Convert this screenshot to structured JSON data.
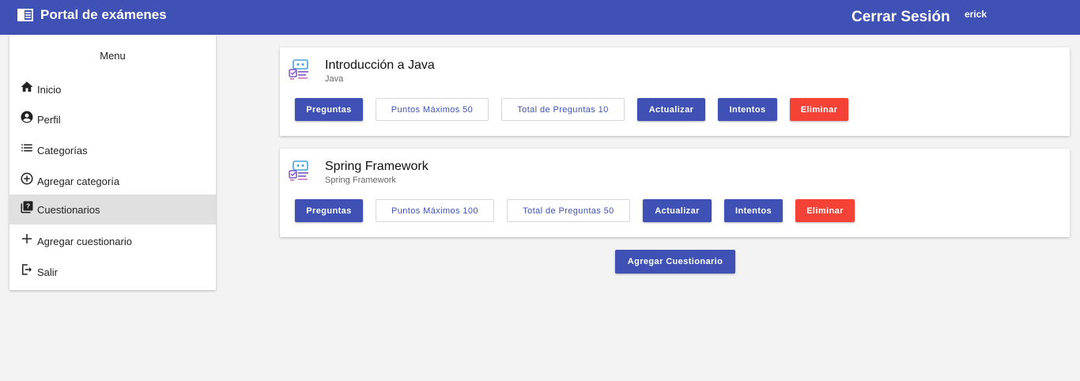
{
  "header": {
    "brand_icon": "chrome-reader-mode-icon",
    "title": "Portal de exámenes",
    "logout_label": "Cerrar Sesión",
    "username": "erick",
    "color": "#3f51b5"
  },
  "sidebar": {
    "title": "Menu",
    "items": [
      {
        "label": "Inicio",
        "icon": "home-icon",
        "active": false
      },
      {
        "label": "Perfil",
        "icon": "account-circle-icon",
        "active": false
      },
      {
        "label": "Categorías",
        "icon": "list-icon",
        "active": false
      },
      {
        "label": "Agregar categoría",
        "icon": "add-circle-outline-icon",
        "active": false
      },
      {
        "label": "Cuestionarios",
        "icon": "quiz-icon",
        "active": true
      },
      {
        "label": "Agregar cuestionario",
        "icon": "plus-icon",
        "active": false
      },
      {
        "label": "Salir",
        "icon": "logout-icon",
        "active": false
      }
    ]
  },
  "quizzes": [
    {
      "title": "Introducción a Java",
      "category": "Java",
      "questions_label": "Preguntas",
      "max_points": "Puntos Máximos 50",
      "total_questions": "Total de Preguntas 10",
      "update_label": "Actualizar",
      "attempts_label": "Intentos",
      "delete_label": "Eliminar"
    },
    {
      "title": "Spring Framework",
      "category": "Spring Framework",
      "questions_label": "Preguntas",
      "max_points": "Puntos Máximos 100",
      "total_questions": "Total de Preguntas 50",
      "update_label": "Actualizar",
      "attempts_label": "Intentos",
      "delete_label": "Eliminar"
    }
  ],
  "add_quiz_label": "Agregar Cuestionario",
  "colors": {
    "primary": "#3f51b5",
    "warn": "#f44336",
    "active_item": "#e0e0e0"
  }
}
